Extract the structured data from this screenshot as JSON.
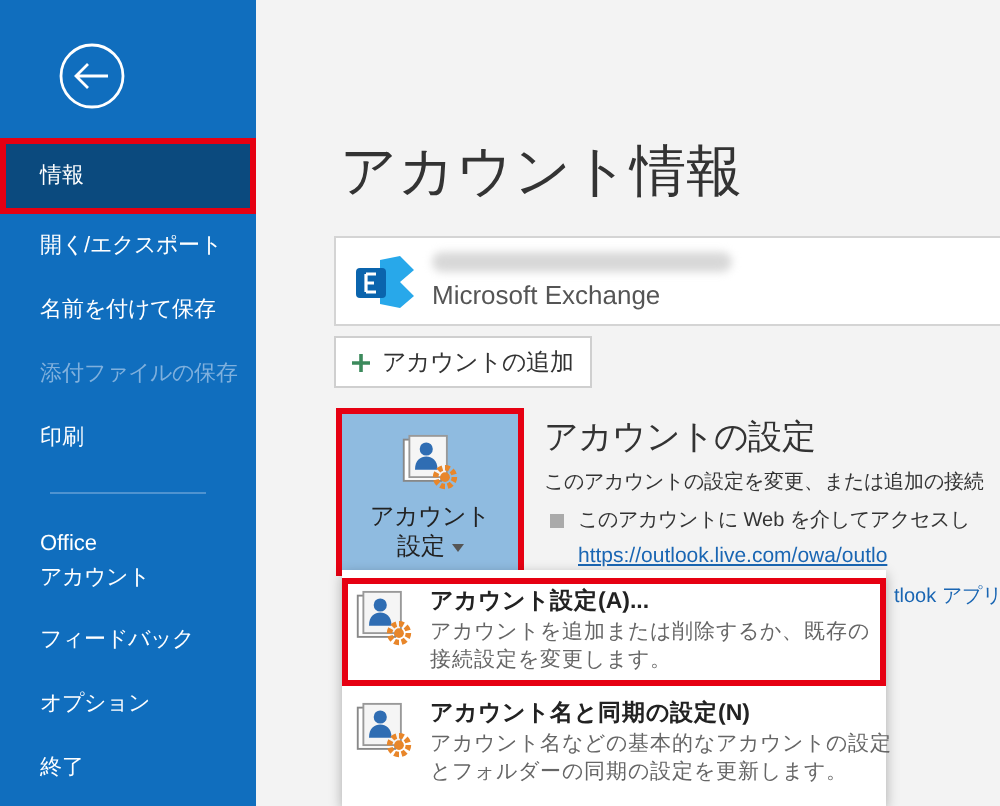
{
  "sidebar": {
    "items": [
      {
        "lines": [
          "情報"
        ],
        "selected": true,
        "disabled": false,
        "highlighted": true
      },
      {
        "lines": [
          "開く/エクスポート"
        ],
        "selected": false,
        "disabled": false,
        "highlighted": false
      },
      {
        "lines": [
          "名前を付けて保存"
        ],
        "selected": false,
        "disabled": false,
        "highlighted": false
      },
      {
        "lines": [
          "添付ファイルの保存"
        ],
        "selected": false,
        "disabled": true,
        "highlighted": false
      },
      {
        "lines": [
          "印刷"
        ],
        "selected": false,
        "disabled": false,
        "highlighted": false
      },
      {
        "kind": "divider"
      },
      {
        "lines": [
          "Office",
          "アカウント"
        ],
        "selected": false,
        "disabled": false,
        "highlighted": false
      },
      {
        "lines": [
          "フィードバック"
        ],
        "selected": false,
        "disabled": false,
        "highlighted": false
      },
      {
        "lines": [
          "オプション"
        ],
        "selected": false,
        "disabled": false,
        "highlighted": false
      },
      {
        "lines": [
          "終了"
        ],
        "selected": false,
        "disabled": false,
        "highlighted": false
      }
    ]
  },
  "main": {
    "title": "アカウント情報",
    "account": {
      "type": "Microsoft Exchange"
    },
    "add_account_button": "アカウントの追加",
    "settings_button": {
      "lines": [
        "アカウント",
        "設定"
      ],
      "highlighted": true
    },
    "settings_section": {
      "heading": "アカウントの設定",
      "description": "このアカウントの設定を変更、または追加の接続",
      "bullet": "このアカウントに Web を介してアクセスし",
      "link": "https://outlook.live.com/owa/outlo",
      "partial_text": "tlook アプリ"
    },
    "dropdown": [
      {
        "title": "アカウント設定(A)...",
        "description_lines": [
          "アカウントを追加または削除するか、既存の",
          "接続設定を変更します。"
        ],
        "highlighted": true
      },
      {
        "title": "アカウント名と同期の設定(N)",
        "description_lines": [
          "アカウント名などの基本的なアカウントの設定",
          "とフォルダーの同期の設定を更新します。"
        ],
        "highlighted": false
      }
    ]
  }
}
